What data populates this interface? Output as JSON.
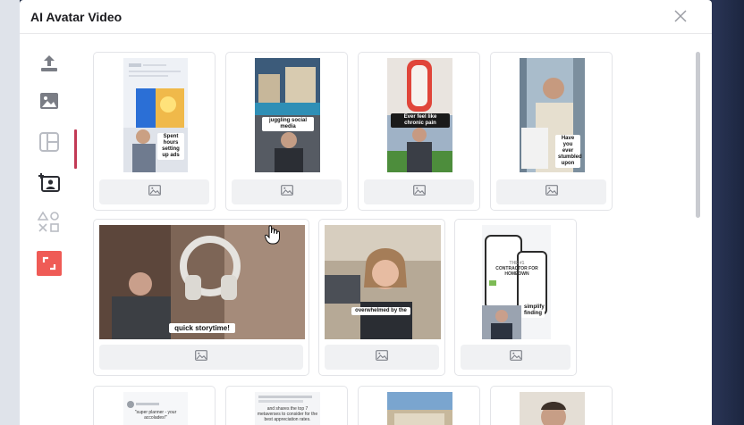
{
  "modal": {
    "title": "AI Avatar Video",
    "close_icon": "close-icon"
  },
  "rail": [
    {
      "name": "upload-icon",
      "color": "#7a7d85"
    },
    {
      "name": "image-icon",
      "color": "#7a7d85"
    },
    {
      "name": "layout-icon",
      "color": "#b9bcc3"
    },
    {
      "name": "avatar-frame-icon",
      "color": "#2b2d33",
      "active": true
    },
    {
      "name": "shapes-icon",
      "color": "#b9bcc3"
    },
    {
      "name": "crop-icon",
      "color": "#ef5b56"
    }
  ],
  "cards": [
    {
      "caption": "Spent hours setting up ads"
    },
    {
      "caption": "juggling social media"
    },
    {
      "caption": "Ever feel like chronic pain"
    },
    {
      "caption": "Have you ever stumbled upon"
    },
    {
      "caption": "quick storytime!"
    },
    {
      "caption": "overwhelmed by the"
    },
    {
      "caption": "simplify finding",
      "poster_lines": [
        "THE #1",
        "CONTRACTOR FOR",
        "HOMEOWN"
      ]
    },
    {
      "caption": "\"super planner - your accolades!\""
    },
    {
      "caption": "and shares the top 7 metaverses to consider for the best appreciation rates."
    }
  ],
  "colors": {
    "accent": "#c23a55",
    "crop": "#ef5b56"
  }
}
